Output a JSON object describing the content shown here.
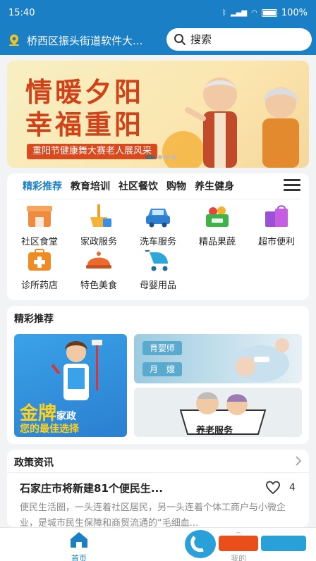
{
  "status_bar": {
    "time": "15:40",
    "battery": "100%"
  },
  "header": {
    "location": "桥西区振头街道软件大...",
    "search_placeholder": "搜索"
  },
  "banner": {
    "title_line1": "情暖夕阳",
    "title_line2": "幸福重阳",
    "subtitle": "重阳节健康舞大赛老人展风采",
    "slides": 4,
    "active_slide": 1
  },
  "category_tabs": [
    "精彩推荐",
    "教育培训",
    "社区餐饮",
    "购物",
    "养生健身"
  ],
  "services": [
    {
      "label": "社区食堂",
      "icon": "canteen-icon",
      "color": "#f08a3e"
    },
    {
      "label": "家政服务",
      "icon": "broom-icon",
      "color": "#e8a42a"
    },
    {
      "label": "洗车服务",
      "icon": "car-wash-icon",
      "color": "#3b8fe0"
    },
    {
      "label": "精品果蔬",
      "icon": "fruit-basket-icon",
      "color": "#3fb24a"
    },
    {
      "label": "超市便利",
      "icon": "shopping-bags-icon",
      "color": "#9a4fd6"
    },
    {
      "label": "诊所药店",
      "icon": "medical-kit-icon",
      "color": "#f08a22"
    },
    {
      "label": "特色美食",
      "icon": "food-cloche-icon",
      "color": "#ee6a2c"
    },
    {
      "label": "母婴用品",
      "icon": "stroller-icon",
      "color": "#2fa6d9"
    }
  ],
  "recommend": {
    "title": "精彩推荐",
    "left": {
      "brand": "金牌",
      "brand_small": "家政",
      "slogan": "您的最佳选择"
    },
    "right_top": {
      "tag1": "育婴师",
      "tag2": "月　嫂"
    },
    "right_bottom": {
      "label": "养老服务"
    }
  },
  "news": {
    "title": "政策资讯",
    "item_title": "石家庄市将新建81个便民生...",
    "likes": "4",
    "item_body": "便民生活圈，一头连着社区居民，另一头连着个体工商户与小微企业，是城市民生保障和商贸流通的“毛细血..."
  },
  "tabbar": {
    "home": "首页",
    "mine": "我的"
  },
  "colors": {
    "primary": "#1a7fc4",
    "banner_red": "#d1421b"
  }
}
